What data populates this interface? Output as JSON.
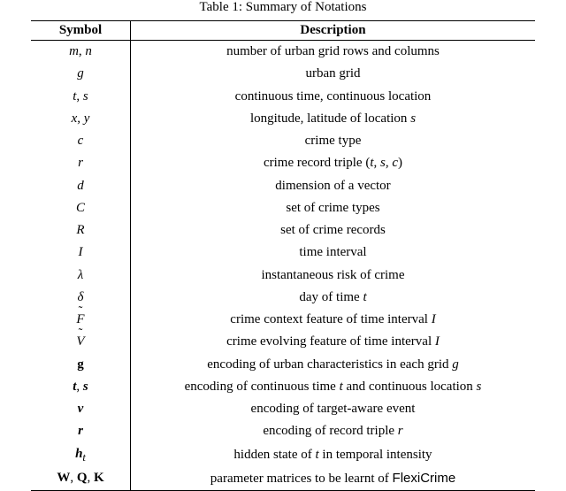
{
  "caption": "Table 1: Summary of Notations",
  "headers": {
    "symbol": "Symbol",
    "description": "Description"
  },
  "rows": [
    {
      "sym_html": "<span class='it'>m</span>, <span class='it'>n</span>",
      "desc_html": "number of urban grid rows and columns"
    },
    {
      "sym_html": "<span class='it'>g</span>",
      "desc_html": "urban grid"
    },
    {
      "sym_html": "<span class='it'>t</span>, <span class='it'>s</span>",
      "desc_html": "continuous time, continuous location"
    },
    {
      "sym_html": "<span class='it'>x</span>, <span class='it'>y</span>",
      "desc_html": "longitude, latitude of location <span class='it'>s</span>"
    },
    {
      "sym_html": "<span class='it'>c</span>",
      "desc_html": "crime type"
    },
    {
      "sym_html": "<span class='it'>r</span>",
      "desc_html": "crime record triple (<span class='it'>t</span>, <span class='it'>s</span>, <span class='it'>c</span>)"
    },
    {
      "sym_html": "<span class='it'>d</span>",
      "desc_html": "dimension of a vector"
    },
    {
      "sym_html": "<span class='it'>C</span>",
      "desc_html": "set of crime types"
    },
    {
      "sym_html": "<span class='it'>R</span>",
      "desc_html": "set of crime records"
    },
    {
      "sym_html": "<span class='it'>I</span>",
      "desc_html": "time interval"
    },
    {
      "sym_html": "<span class='it'>λ</span>",
      "desc_html": "instantaneous risk of crime"
    },
    {
      "sym_html": "<span class='it'>δ</span>",
      "desc_html": "day of time <span class='it'>t</span>"
    },
    {
      "sym_html": "<span class='tilde-wrap'><span class='tilde'>˜</span><span class='it'>F</span></span>",
      "desc_html": "crime context feature of time interval <span class='it'>I</span>"
    },
    {
      "sym_html": "<span class='tilde-wrap'><span class='tilde'>˜</span><span class='it'>V</span></span>",
      "desc_html": "crime evolving feature of time interval <span class='it'>I</span>"
    },
    {
      "sym_html": "<span class='bd'>g</span>",
      "desc_html": "encoding of urban characteristics in each grid <span class='it'>g</span>"
    },
    {
      "sym_html": "<span class='bd it'>t</span>, <span class='bd it'>s</span>",
      "desc_html": "encoding of continuous time <span class='it'>t</span> and continuous location <span class='it'>s</span>"
    },
    {
      "sym_html": "<span class='bd it'>v</span>",
      "desc_html": "encoding of target-aware event"
    },
    {
      "sym_html": "<span class='bd it'>r</span>",
      "desc_html": "encoding of record triple <span class='it'>r</span>"
    },
    {
      "sym_html": "<span class='bd it'>h</span><sub class='it'>t</sub>",
      "desc_html": "hidden state of <span class='it'>t</span> in temporal intensity"
    },
    {
      "sym_html": "<span class='bd'>W</span>, <span class='bd'>Q</span>, <span class='bd'>K</span>",
      "desc_html": "parameter matrices to be learnt of <span class='sans'>FlexiCrime</span>"
    }
  ]
}
